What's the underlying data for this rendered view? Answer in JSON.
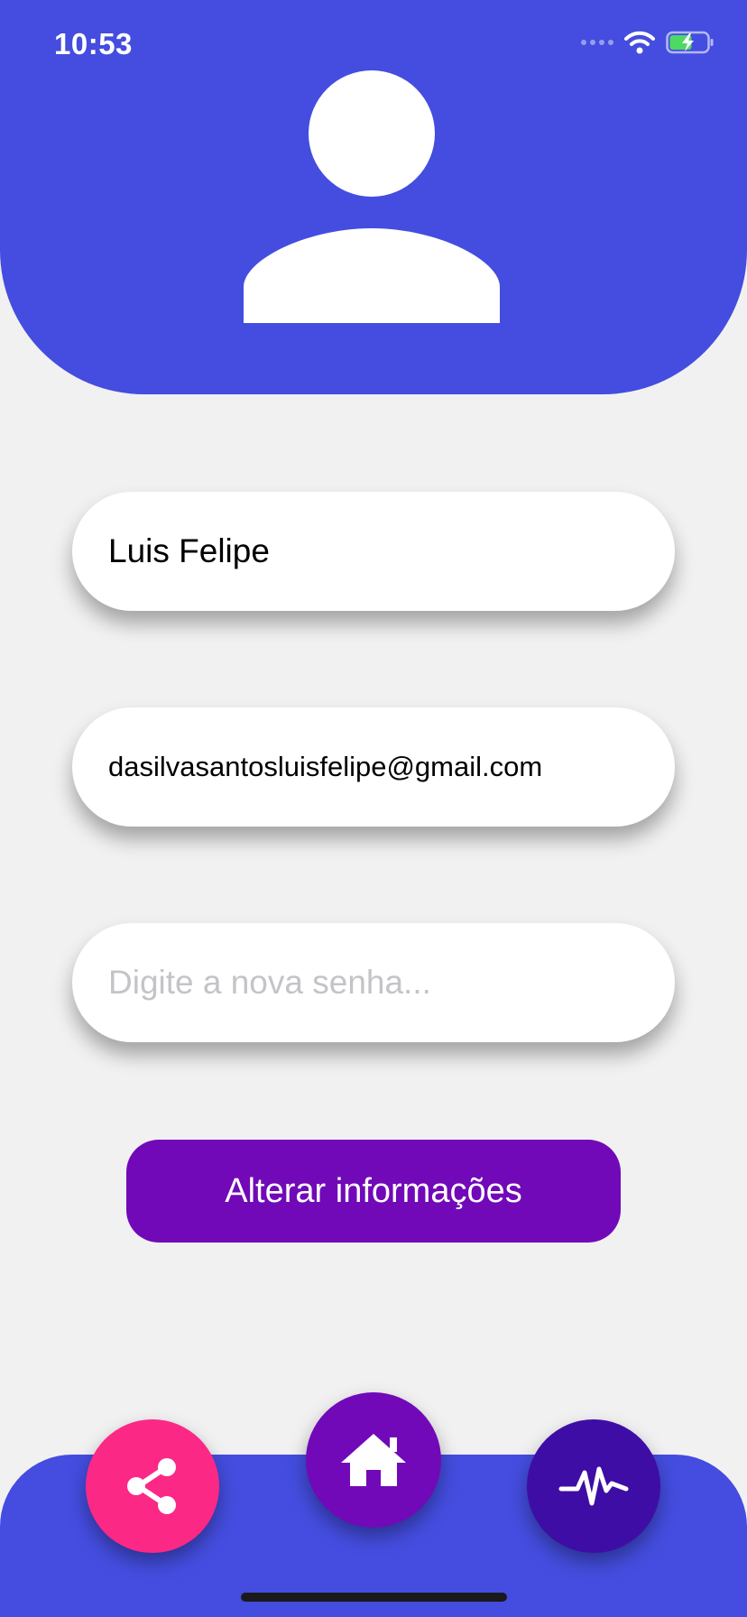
{
  "status_bar": {
    "time": "10:53",
    "icons": [
      "signal-dots-icon",
      "wifi-icon",
      "battery-charging-icon"
    ]
  },
  "profile": {
    "avatar_icon": "person-icon",
    "name_value": "Luis Felipe",
    "email_value": "dasilvasantosluisfelipe@gmail.com",
    "password_placeholder": "Digite a nova senha..."
  },
  "actions": {
    "submit_label": "Alterar informações"
  },
  "tab_bar": {
    "buttons": [
      {
        "icon": "share-icon",
        "color": "#FB2886"
      },
      {
        "icon": "home-icon",
        "color": "#7109B8"
      },
      {
        "icon": "activity-icon",
        "color": "#3E0DA6"
      }
    ]
  },
  "colors": {
    "primary": "#444DDF",
    "accent_purple": "#7109B8",
    "accent_pink": "#FB2886",
    "accent_indigo": "#3E0DA6",
    "background": "#F1F1F2"
  }
}
